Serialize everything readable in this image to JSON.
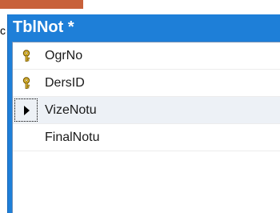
{
  "window": {
    "title": "TblNot *"
  },
  "stray_char": "c",
  "columns": [
    {
      "name": "OgrNo",
      "is_key": true,
      "selected": false
    },
    {
      "name": "DersID",
      "is_key": true,
      "selected": false
    },
    {
      "name": "VizeNotu",
      "is_key": false,
      "selected": true
    },
    {
      "name": "FinalNotu",
      "is_key": false,
      "selected": false
    }
  ],
  "colors": {
    "title_bar": "#1e7fd8",
    "top_tab": "#c8613a",
    "key_icon": "#e8c23a",
    "selected_row": "#edf1f6"
  },
  "icons": {
    "primary_key": "key-icon",
    "row_selector": "triangle-right-icon"
  }
}
